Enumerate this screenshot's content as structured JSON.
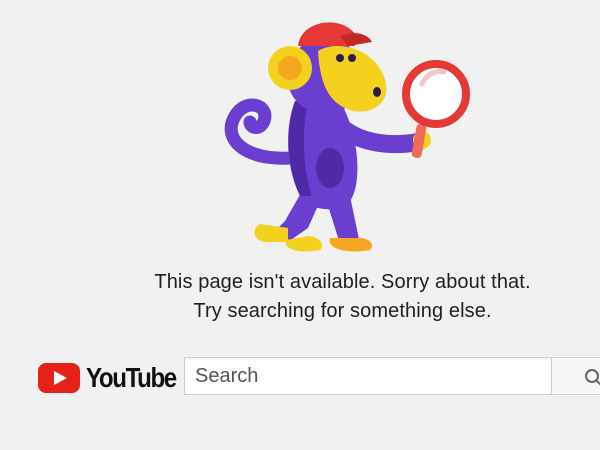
{
  "error": {
    "line1": "This page isn't available. Sorry about that.",
    "line2": "Try searching for something else."
  },
  "logo": {
    "text": "YouTube",
    "icon": "youtube-play-icon",
    "icon_color": "#e62117"
  },
  "search": {
    "placeholder": "Search",
    "button_icon": "search-icon"
  },
  "illustration": {
    "subject": "monkey-with-magnifying-glass",
    "colors": {
      "body": "#6a3fd0",
      "body_dark": "#4f2aa6",
      "face": "#f5d11f",
      "cap": "#e53935",
      "glass": "#e53935",
      "handle": "#ef6c57"
    }
  }
}
